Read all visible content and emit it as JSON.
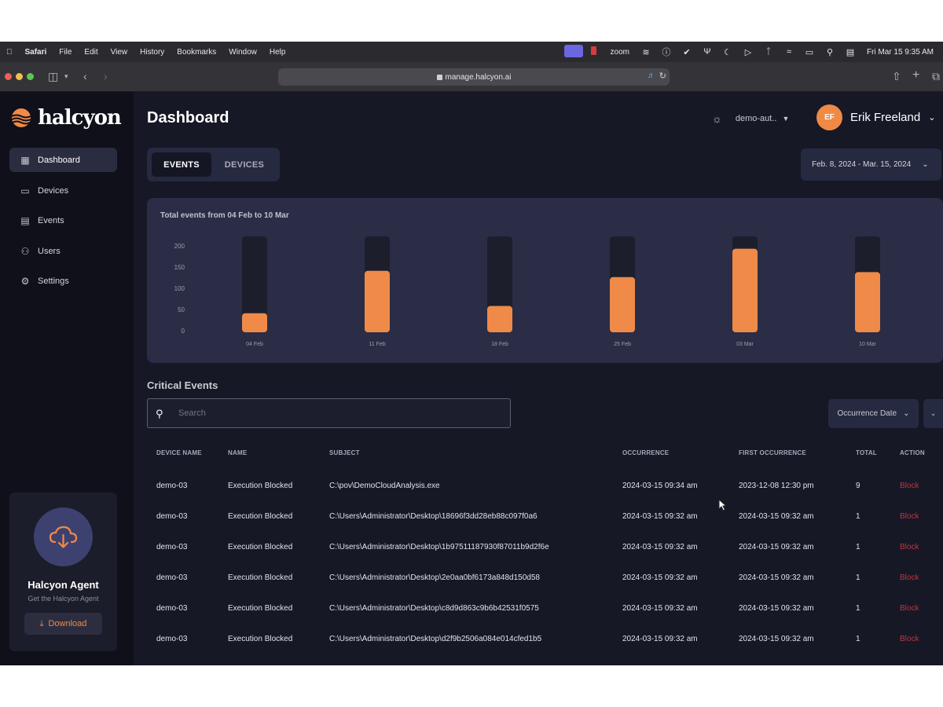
{
  "menubar": {
    "items": [
      "Safari",
      "File",
      "Edit",
      "View",
      "History",
      "Bookmarks",
      "Window",
      "Help"
    ],
    "zoom_label": "zoom",
    "clock": "Fri Mar 15  9:35 AM"
  },
  "browser": {
    "url": "manage.halcyon.ai"
  },
  "sidebar": {
    "brand": "halcyon",
    "nav": [
      {
        "label": "Dashboard",
        "icon": "grid-icon"
      },
      {
        "label": "Devices",
        "icon": "monitor-icon"
      },
      {
        "label": "Events",
        "icon": "calendar-icon"
      },
      {
        "label": "Users",
        "icon": "users-icon"
      },
      {
        "label": "Settings",
        "icon": "gear-icon"
      }
    ],
    "agent": {
      "title": "Halcyon Agent",
      "subtitle": "Get the Halcyon Agent",
      "download_label": "Download"
    }
  },
  "header": {
    "title": "Dashboard",
    "org": "demo-aut..",
    "user_initials": "EF",
    "user_name": "Erik Freeland"
  },
  "tabs": [
    {
      "label": "EVENTS",
      "active": true
    },
    {
      "label": "DEVICES",
      "active": false
    }
  ],
  "date_range": "Feb. 8, 2024 - Mar. 15, 2024",
  "chart_data": {
    "type": "bar",
    "title": "Total events from 04 Feb to 10 Mar",
    "categories": [
      "04 Feb",
      "11 Feb",
      "18 Feb",
      "25 Feb",
      "03 Mar",
      "10 Mar"
    ],
    "values": [
      45,
      145,
      62,
      130,
      197,
      142
    ],
    "yticks": [
      0,
      50,
      100,
      150,
      200
    ],
    "ylim": [
      0,
      225
    ],
    "grid": false,
    "bar_color": "#ef8a48",
    "track_color": "#1c1e2c"
  },
  "critical": {
    "title": "Critical Events",
    "search_placeholder": "Search",
    "sort_label": "Occurrence Date",
    "columns": [
      "DEVICE NAME",
      "NAME",
      "SUBJECT",
      "OCCURRENCE",
      "FIRST OCCURRENCE",
      "TOTAL",
      "ACTION"
    ],
    "rows": [
      [
        "demo-03",
        "Execution Blocked",
        "C:\\pov\\DemoCloudAnalysis.exe",
        "2024-03-15 09:34 am",
        "2023-12-08 12:30 pm",
        "9",
        "Block"
      ],
      [
        "demo-03",
        "Execution Blocked",
        "C:\\Users\\Administrator\\Desktop\\18696f3dd28eb88c097f0a6",
        "2024-03-15 09:32 am",
        "2024-03-15 09:32 am",
        "1",
        "Block"
      ],
      [
        "demo-03",
        "Execution Blocked",
        "C:\\Users\\Administrator\\Desktop\\1b97511187930f87011b9d2f6e",
        "2024-03-15 09:32 am",
        "2024-03-15 09:32 am",
        "1",
        "Block"
      ],
      [
        "demo-03",
        "Execution Blocked",
        "C:\\Users\\Administrator\\Desktop\\2e0aa0bf6173a848d150d58",
        "2024-03-15 09:32 am",
        "2024-03-15 09:32 am",
        "1",
        "Block"
      ],
      [
        "demo-03",
        "Execution Blocked",
        "C:\\Users\\Administrator\\Desktop\\c8d9d863c9b6b42531f0575",
        "2024-03-15 09:32 am",
        "2024-03-15 09:32 am",
        "1",
        "Block"
      ],
      [
        "demo-03",
        "Execution Blocked",
        "C:\\Users\\Administrator\\Desktop\\d2f9b2506a084e014cfed1b5",
        "2024-03-15 09:32 am",
        "2024-03-15 09:32 am",
        "1",
        "Block"
      ]
    ]
  },
  "colors": {
    "accent": "#ef8a48",
    "block": "#c0353f",
    "sidebar_bg": "#0f1019",
    "main_bg": "#161826",
    "card_bg": "#2a2d45"
  }
}
